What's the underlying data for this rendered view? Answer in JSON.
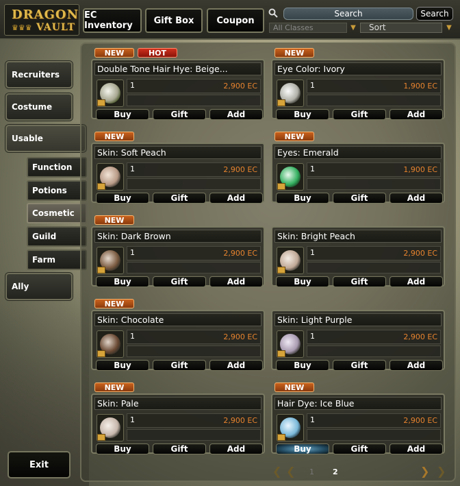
{
  "logo": {
    "line1": "DRAGON",
    "line2": "VAULT",
    "crown": "♛♛♛"
  },
  "topbar": {
    "ec_inventory": "EC Inventory",
    "gift_box": "Gift Box",
    "coupon": "Coupon"
  },
  "search": {
    "placeholder": "Search",
    "button": "Search"
  },
  "filters": {
    "classes": "All Classes",
    "sort": "Sort"
  },
  "sidebar": {
    "items": [
      {
        "label": "Recruiters"
      },
      {
        "label": "Costume"
      },
      {
        "label": "Usable"
      },
      {
        "label": "Function"
      },
      {
        "label": "Potions"
      },
      {
        "label": "Cosmetic"
      },
      {
        "label": "Guild"
      },
      {
        "label": "Farm"
      },
      {
        "label": "Ally"
      }
    ],
    "exit": "Exit"
  },
  "badges": {
    "new": "NEW",
    "hot": "HOT"
  },
  "buttons": {
    "buy": "Buy",
    "gift": "Gift",
    "add": "Add"
  },
  "items": [
    {
      "name": "Double Tone Hair Hye: Beige...",
      "qty": "1",
      "price": "2,900 EC"
    },
    {
      "name": "Eye Color: Ivory",
      "qty": "1",
      "price": "1,900 EC"
    },
    {
      "name": "Skin: Soft Peach",
      "qty": "1",
      "price": "2,900 EC"
    },
    {
      "name": "Eyes: Emerald",
      "qty": "1",
      "price": "1,900 EC"
    },
    {
      "name": "Skin: Dark Brown",
      "qty": "1",
      "price": "2,900 EC"
    },
    {
      "name": "Skin: Bright Peach",
      "qty": "1",
      "price": "2,900 EC"
    },
    {
      "name": "Skin: Chocolate",
      "qty": "1",
      "price": "2,900 EC"
    },
    {
      "name": "Skin: Light Purple",
      "qty": "1",
      "price": "2,900 EC"
    },
    {
      "name": "Skin: Pale",
      "qty": "1",
      "price": "2,900 EC"
    },
    {
      "name": "Hair Dye: Ice Blue",
      "qty": "1",
      "price": "2,900 EC"
    }
  ],
  "pagination": {
    "page1": "1",
    "page2": "2",
    "current": "2"
  }
}
